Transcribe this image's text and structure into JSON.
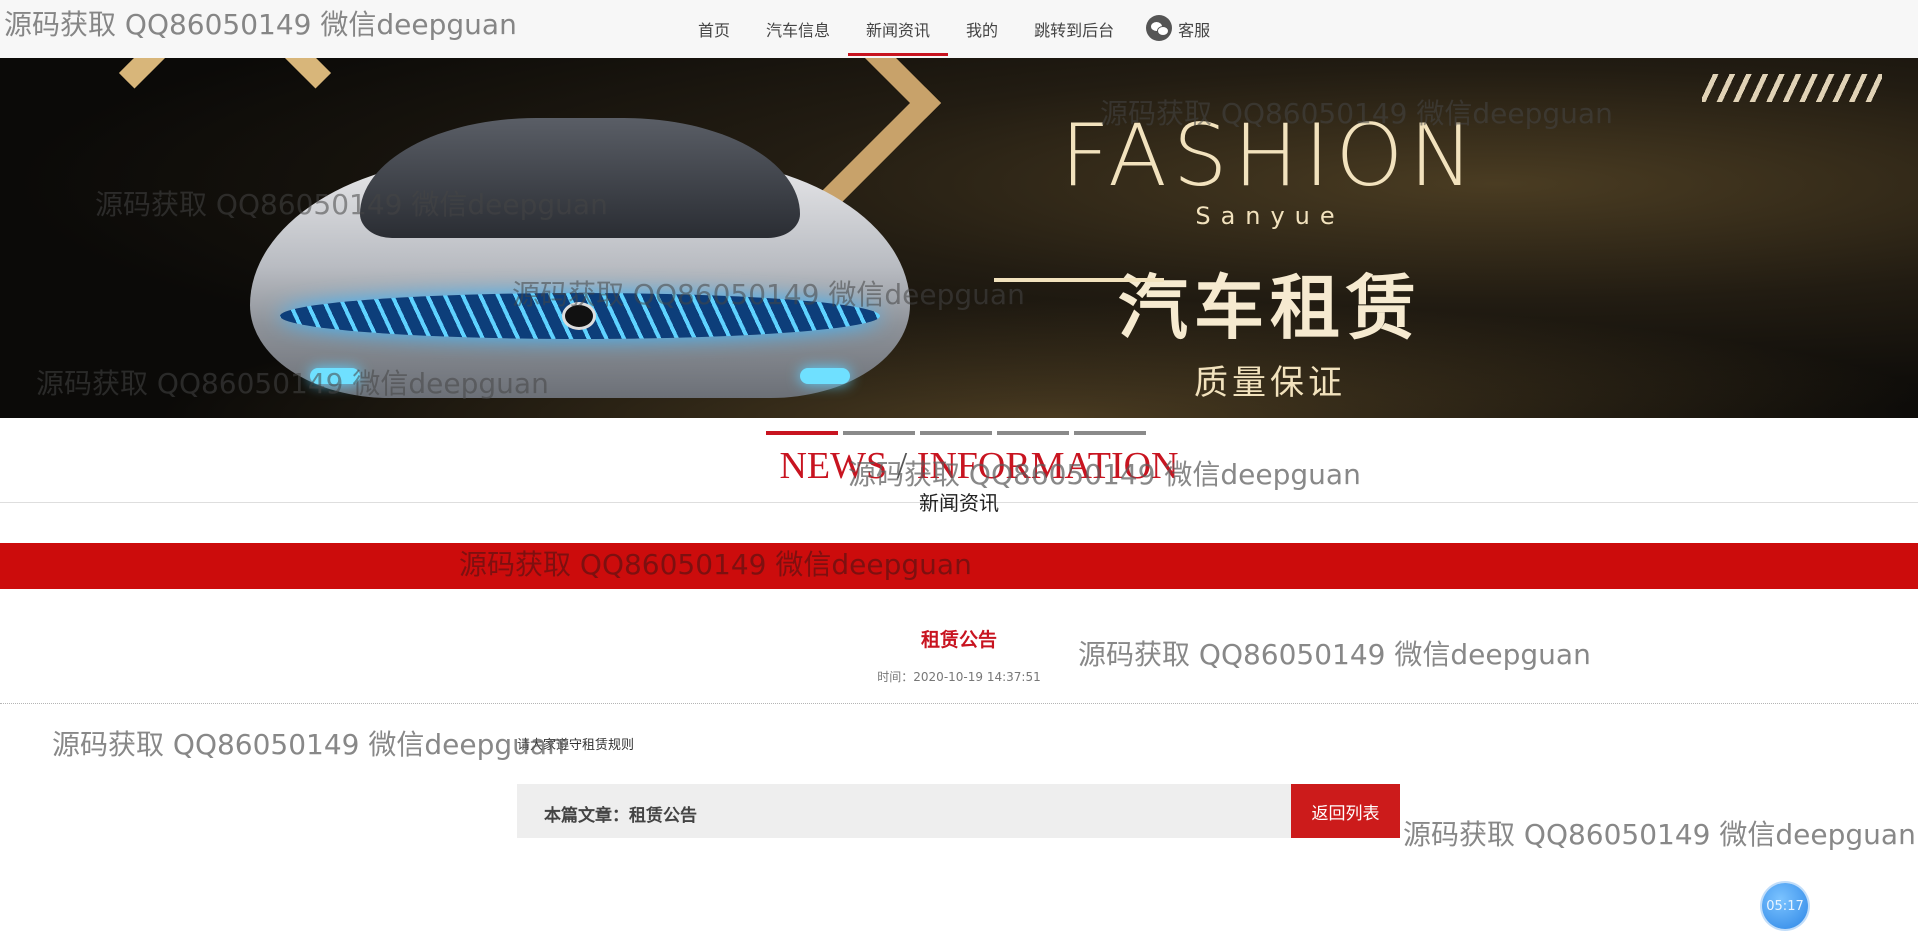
{
  "nav": {
    "items": [
      {
        "label": "首页",
        "active": false
      },
      {
        "label": "汽车信息",
        "active": false
      },
      {
        "label": "新闻资讯",
        "active": true
      },
      {
        "label": "我的",
        "active": false
      },
      {
        "label": "跳转到后台",
        "active": false
      }
    ],
    "service": {
      "icon": "wechat-icon",
      "label": "客服"
    }
  },
  "banner": {
    "headline": "FASHION",
    "subline": "Sanyue",
    "main_text": "汽车租赁",
    "tagline": "质量保证"
  },
  "section": {
    "title_en_1": "NEWS",
    "title_en_sep": " / ",
    "title_en_2": "INFORMATION",
    "title_cn": "新闻资讯",
    "tab_count": 5,
    "active_tab": 0
  },
  "article": {
    "title": "租赁公告",
    "time_label": "时间：",
    "time_value": "2020-10-19 14:37:51",
    "body": "请大家遵守租赁规则",
    "footer_label": "本篇文章：租赁公告",
    "back_label": "返回列表"
  },
  "timer": {
    "value": "05:17"
  },
  "watermark": "源码获取 QQ86050149 微信deepguan",
  "colors": {
    "accent": "#c81420",
    "band": "#cc0c0c",
    "nav_bg": "#f7f7f7",
    "footer_bar": "#eeeeee",
    "timer": "#2d86e6"
  }
}
